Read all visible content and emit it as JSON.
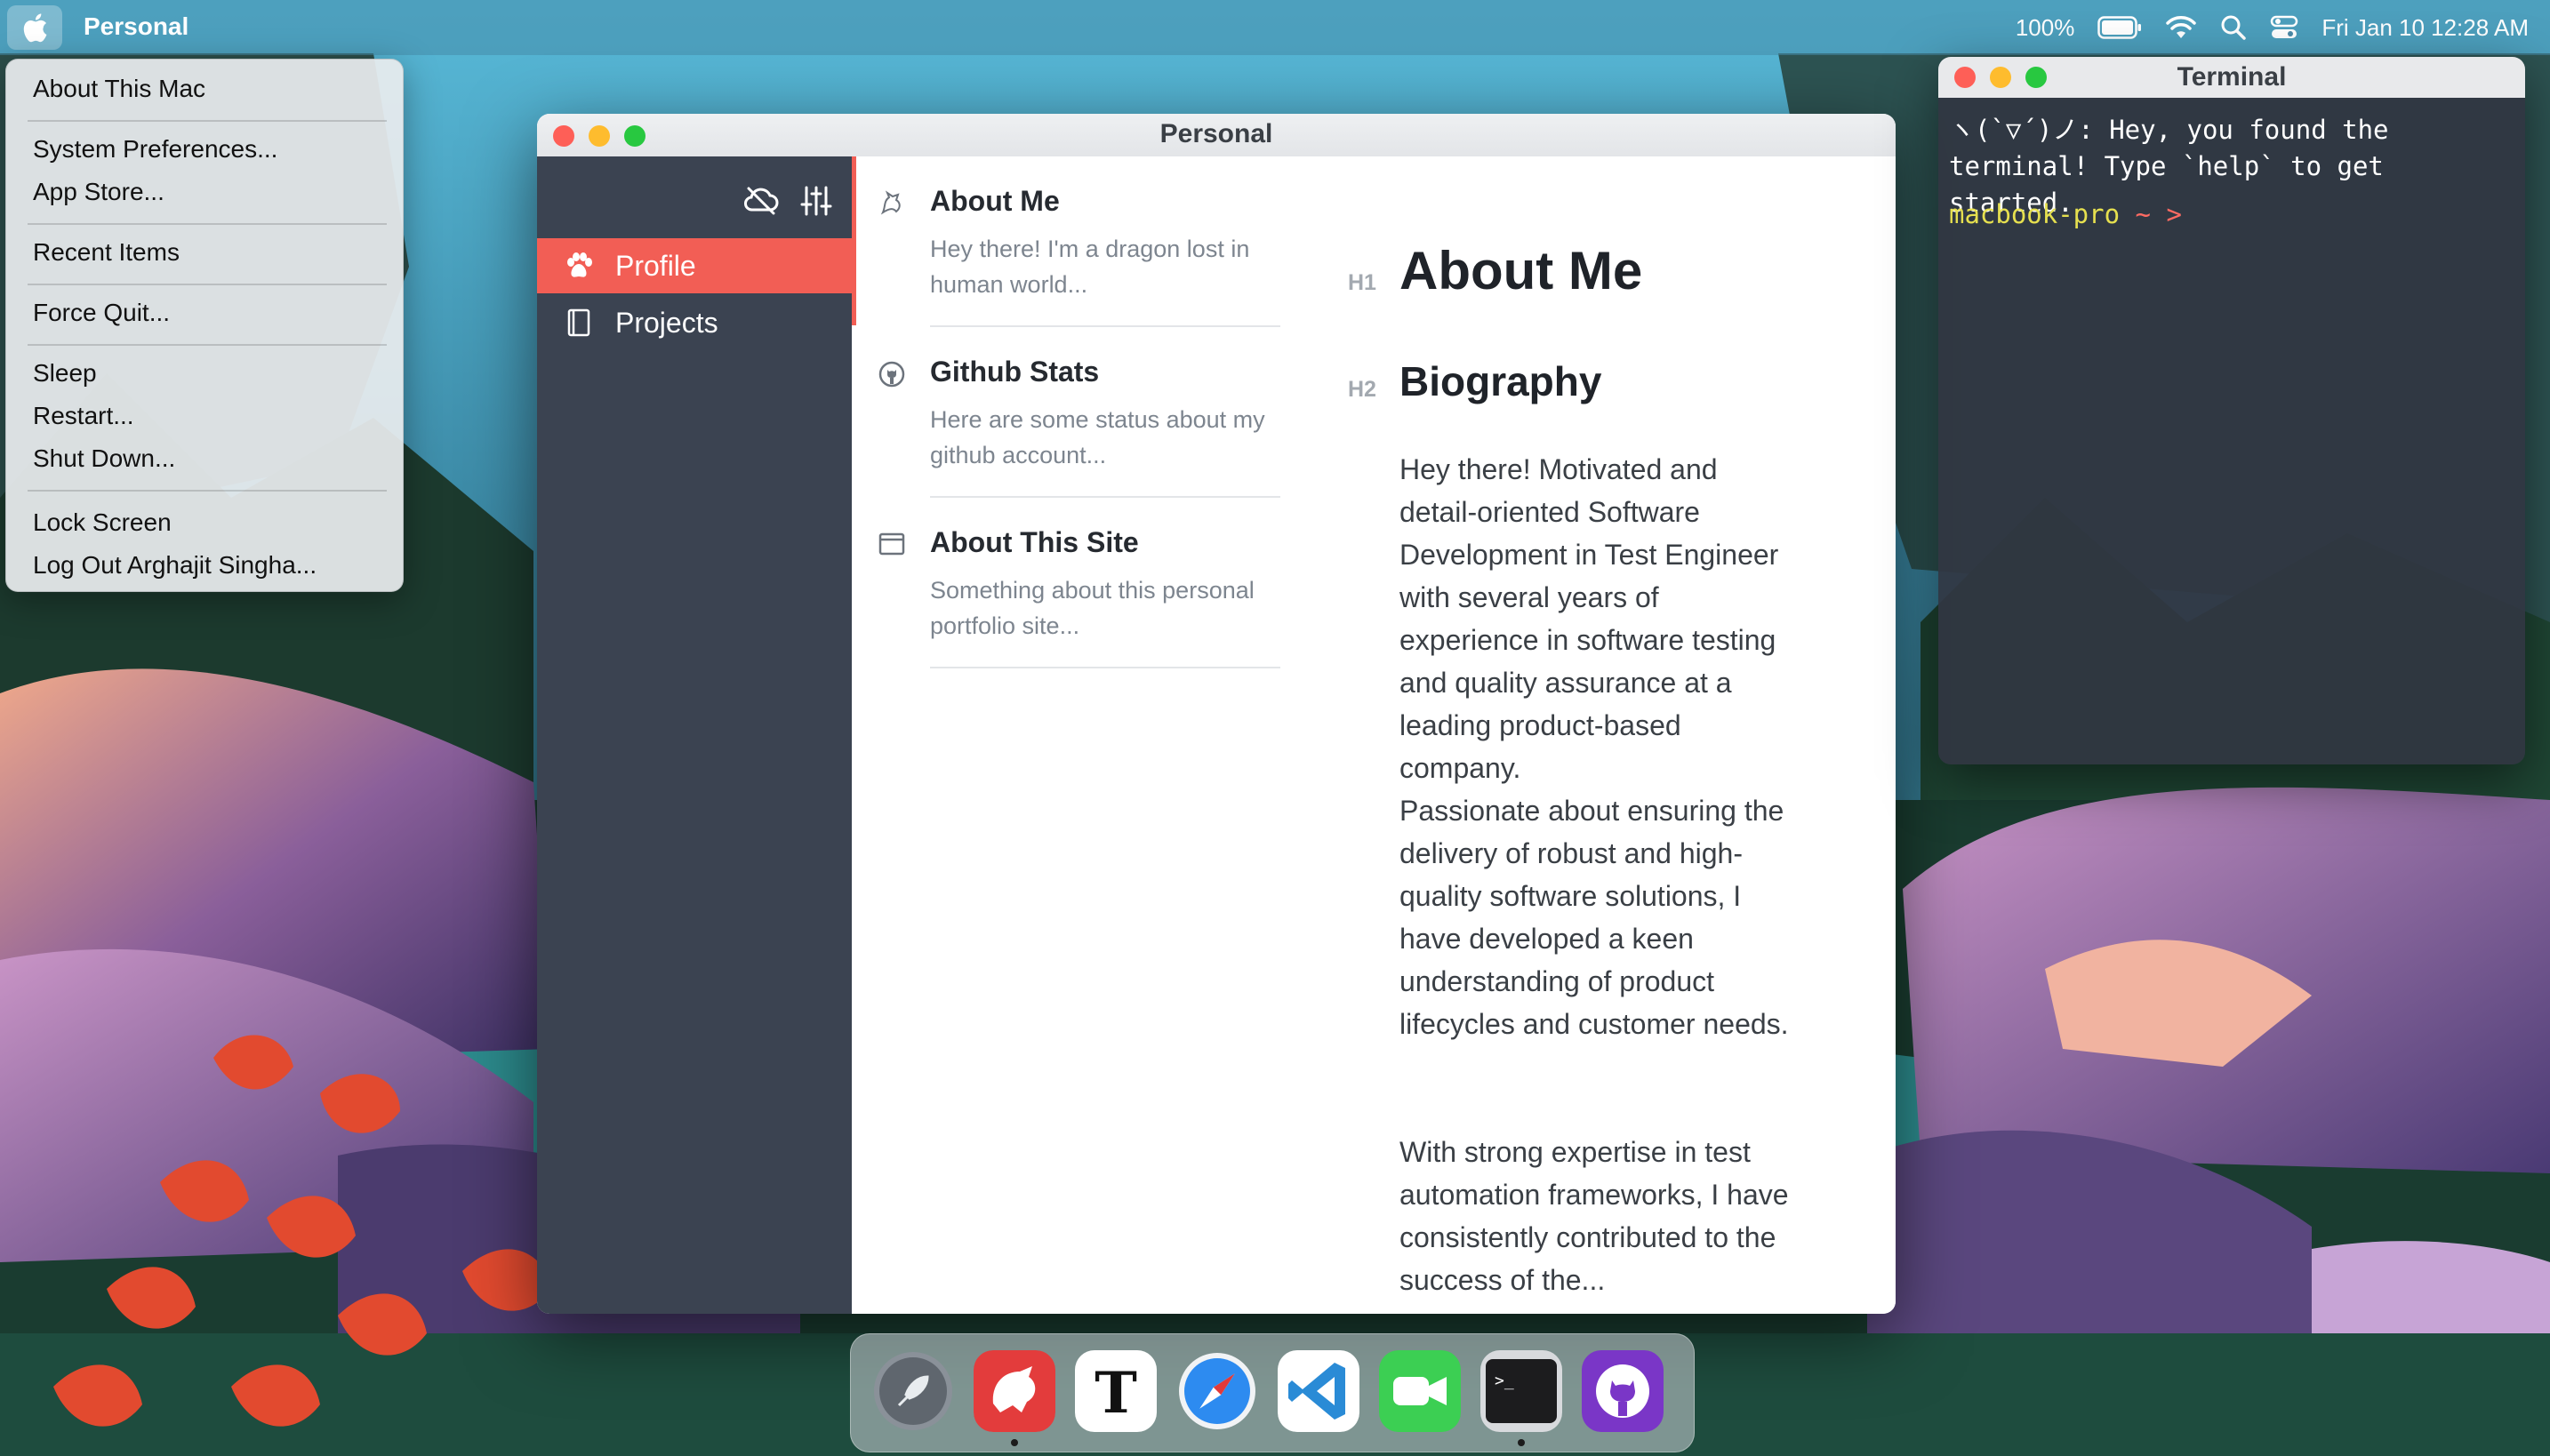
{
  "menubar": {
    "app_name": "Personal",
    "battery": "100%",
    "datetime": "Fri Jan 10  12:28 AM"
  },
  "apple_menu": {
    "items": [
      "About This Mac",
      "System Preferences...",
      "App Store...",
      "Recent Items",
      "Force Quit...",
      "Sleep",
      "Restart...",
      "Shut Down...",
      "Lock Screen",
      "Log Out Arghajit Singha..."
    ]
  },
  "window": {
    "title": "Personal",
    "sidebar": {
      "items": [
        {
          "label": "Profile",
          "icon": "paw-icon",
          "active": true
        },
        {
          "label": "Projects",
          "icon": "book-icon",
          "active": false
        }
      ]
    },
    "list": [
      {
        "title": "About Me",
        "desc": "Hey there! I'm a dragon lost in human world...",
        "icon": "dragon-icon"
      },
      {
        "title": "Github Stats",
        "desc": "Here are some status about my github account...",
        "icon": "github-icon"
      },
      {
        "title": "About This Site",
        "desc": "Something about this personal portfolio site...",
        "icon": "browser-window-icon"
      }
    ],
    "content": {
      "h1_label": "H1",
      "h1": "About Me",
      "h2_label": "H2",
      "h2": "Biography",
      "paragraphs": [
        "Hey there! Motivated and detail-oriented Software Development in Test Engineer with several years of experience in software testing and quality assurance at a leading product-based company.",
        "Passionate about ensuring the delivery of robust and high-quality software solutions, I have developed a keen understanding of product lifecycles and customer needs.",
        "With strong expertise in test automation frameworks, I have consistently contributed to the success of the..."
      ]
    }
  },
  "terminal": {
    "title": "Terminal",
    "greeting": "ヽ(`▽´)ノ: Hey, you found the terminal! Type `help` to get started.",
    "host": "macbook-pro",
    "cwd": "~",
    "prompt_symbol": ">"
  },
  "dock": {
    "apps": [
      {
        "name": "Launchpad",
        "icon": "rocket-icon",
        "running": false
      },
      {
        "name": "Bear",
        "icon": "bear-icon",
        "running": true
      },
      {
        "name": "Typora",
        "icon": "typora-icon",
        "running": false
      },
      {
        "name": "Safari",
        "icon": "safari-compass-icon",
        "running": false
      },
      {
        "name": "Visual Studio Code",
        "icon": "vscode-icon",
        "running": false
      },
      {
        "name": "FaceTime",
        "icon": "facetime-icon",
        "running": false
      },
      {
        "name": "Terminal",
        "icon": "terminal-icon",
        "running": true
      },
      {
        "name": "GitHub",
        "icon": "github-icon",
        "running": false
      }
    ]
  },
  "colors": {
    "accent": "#f25e55",
    "sidebar": "#3b4351",
    "terminal_host": "#e6e04f",
    "terminal_arrow": "#ff6b63"
  }
}
